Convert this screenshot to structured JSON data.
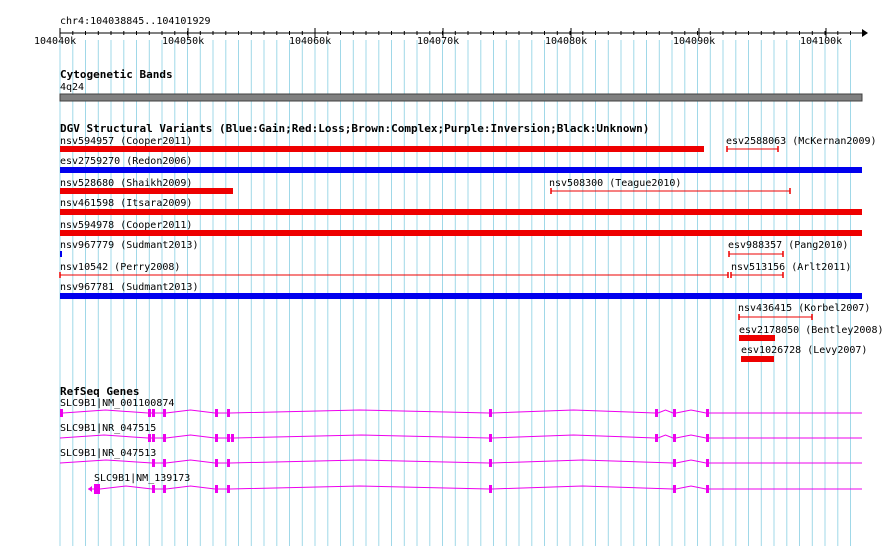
{
  "ruler": {
    "label": "chr4:104038845..104101929",
    "ticks": [
      "104040k",
      "104050k",
      "104060k",
      "104070k",
      "104080k",
      "104090k",
      "104100k"
    ]
  },
  "cytoband": {
    "title": "Cytogenetic Bands",
    "band": "4q24"
  },
  "dgv": {
    "title": "DGV Structural Variants (Blue:Gain;Red:Loss;Brown:Complex;Purple:Inversion;Black:Unknown)",
    "variants": [
      {
        "label": "nsv594957 (Cooper2011)",
        "type": "Loss",
        "style": "thick"
      },
      {
        "label": "esv2588063 (McKernan2009)",
        "type": "Loss",
        "style": "thin"
      },
      {
        "label": "esv2759270 (Redon2006)",
        "type": "Gain",
        "style": "thick"
      },
      {
        "label": "nsv528680 (Shaikh2009)",
        "type": "Loss",
        "style": "thick"
      },
      {
        "label": "nsv508300 (Teague2010)",
        "type": "Loss",
        "style": "thin"
      },
      {
        "label": "nsv461598 (Itsara2009)",
        "type": "Loss",
        "style": "thick"
      },
      {
        "label": "nsv594978 (Cooper2011)",
        "type": "Loss",
        "style": "thick"
      },
      {
        "label": "nsv967779 (Sudmant2013)",
        "type": "Gain",
        "style": "thick"
      },
      {
        "label": "esv988357 (Pang2010)",
        "type": "Loss",
        "style": "thin"
      },
      {
        "label": "nsv10542 (Perry2008)",
        "type": "Loss",
        "style": "thin"
      },
      {
        "label": "nsv513156 (Arlt2011)",
        "type": "Loss",
        "style": "thin"
      },
      {
        "label": "nsv967781 (Sudmant2013)",
        "type": "Gain",
        "style": "thick"
      },
      {
        "label": "nsv436415 (Korbel2007)",
        "type": "Loss",
        "style": "thin"
      },
      {
        "label": "esv2178050 (Bentley2008)",
        "type": "Loss",
        "style": "thick"
      },
      {
        "label": "esv1026728 (Levy2007)",
        "type": "Loss",
        "style": "thick"
      }
    ]
  },
  "refseq": {
    "title": "RefSeq Genes",
    "genes": [
      {
        "label": "SLC9B1|NM_001100874"
      },
      {
        "label": "SLC9B1|NR_047515"
      },
      {
        "label": "SLC9B1|NR_047513"
      },
      {
        "label": "SLC9B1|NM_139173"
      }
    ]
  },
  "colors": {
    "gain": "#0000ee",
    "loss": "#ee0000",
    "gene": "#ee00ee",
    "grid": "#a0d8e8",
    "band": "#808080"
  }
}
